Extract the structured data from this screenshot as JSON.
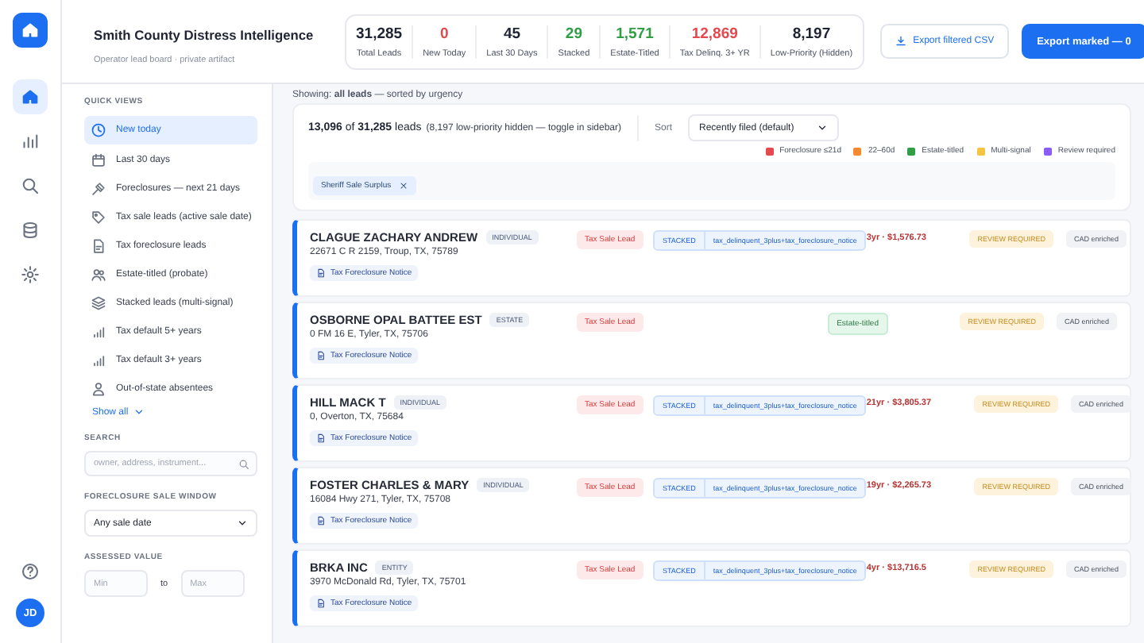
{
  "rail": {
    "avatar": "JD",
    "items": [
      {
        "kind": "home",
        "selected": true
      },
      {
        "kind": "chart",
        "selected": false
      },
      {
        "kind": "search",
        "selected": false
      },
      {
        "kind": "database",
        "selected": false
      },
      {
        "kind": "settings",
        "selected": false
      }
    ]
  },
  "header": {
    "title": "Smith County Distress Intelligence",
    "subtitle": "Operator lead board · private artifact",
    "stats": [
      {
        "value": "31,285",
        "label": "Total Leads",
        "color": "#1f2433"
      },
      {
        "value": "0",
        "label": "New Today",
        "color": "#e5484d"
      },
      {
        "value": "45",
        "label": "Last 30 Days",
        "color": "#1f2433"
      },
      {
        "value": "29",
        "label": "Stacked",
        "color": "#2f9e44"
      },
      {
        "value": "1,571",
        "label": "Estate-Titled",
        "color": "#2f9e44"
      },
      {
        "value": "12,869",
        "label": "Tax Delinq. 3+ YR",
        "color": "#e5484d"
      },
      {
        "value": "8,197",
        "label": "Low-Priority (Hidden)",
        "color": "#1f2433"
      }
    ],
    "csv_button": "Export filtered CSV",
    "export_button": "Export marked — 0"
  },
  "sidebar": {
    "quick_views_title": "QUICK VIEWS",
    "quick_views": [
      {
        "label": "New today",
        "kind": "clock",
        "selected": true
      },
      {
        "label": "Last 30 days",
        "kind": "calendar",
        "selected": false
      },
      {
        "label": "Foreclosures — next 21 days",
        "kind": "gavel",
        "selected": false
      },
      {
        "label": "Tax sale leads (active sale date)",
        "kind": "tag",
        "selected": false
      },
      {
        "label": "Tax foreclosure leads",
        "kind": "doc",
        "selected": false
      },
      {
        "label": "Estate-titled (probate)",
        "kind": "people",
        "selected": false
      },
      {
        "label": "Stacked leads (multi-signal)",
        "kind": "layers",
        "selected": false
      },
      {
        "label": "Tax default 5+ years",
        "kind": "bars",
        "selected": false
      },
      {
        "label": "Tax default 3+ years",
        "kind": "bars",
        "selected": false
      },
      {
        "label": "Out-of-state absentees",
        "kind": "person",
        "selected": false
      }
    ],
    "show_all": "Show all",
    "search_label": "SEARCH",
    "search_placeholder": "owner, address, instrument...",
    "window_label": "FORECLOSURE SALE WINDOW",
    "window_value": "Any sale date",
    "assessed_label": "ASSESSED VALUE",
    "min_placeholder": "Min",
    "to": "to",
    "max_placeholder": "Max"
  },
  "main": {
    "showing": "Showing: **all leads** — sorted by urgency",
    "count": "**13,096** of **31,285** leads",
    "count_note": "(8,197 low-priority hidden — toggle in sidebar)",
    "sort_label": "Sort",
    "sort_value": "Recently filed (default)",
    "legend": [
      {
        "label": "Foreclosure ≤21d",
        "color": "#e5484d"
      },
      {
        "label": "22–60d",
        "color": "#f5892f"
      },
      {
        "label": "Estate-titled",
        "color": "#2f9e44"
      },
      {
        "label": "Multi-signal",
        "color": "#f5c542"
      },
      {
        "label": "Review required",
        "color": "#8b5cf6"
      }
    ],
    "chips": [
      "Sheriff Sale Surplus"
    ],
    "leads": [
      {
        "name": "CLAGUE ZACHARY ANDREW",
        "type": "INDIVIDUAL",
        "address": "22671 C R 2159, Troup, TX, 75789",
        "notice": "Tax Foreclosure Notice",
        "lead_tag": "Tax Sale Lead",
        "stacked": "STACKED",
        "signals": "tax_delinquent_3plus+tax_foreclosure_notice",
        "amount": "3yr · $1,576.73",
        "review": "REVIEW REQUIRED",
        "enrichment": "CAD enriched"
      },
      {
        "name": "OSBORNE OPAL BATTEE EST",
        "type": "ESTATE",
        "address": "0 FM 16 E, Tyler, TX, 75706",
        "notice": "Tax Foreclosure Notice",
        "lead_tag": "Tax Sale Lead",
        "estate_tag": "Estate-titled",
        "review": "REVIEW REQUIRED",
        "enrichment": "CAD enriched"
      },
      {
        "name": "HILL MACK T",
        "type": "INDIVIDUAL",
        "address": "0, Overton, TX, 75684",
        "notice": "Tax Foreclosure Notice",
        "lead_tag": "Tax Sale Lead",
        "stacked": "STACKED",
        "signals": "tax_delinquent_3plus+tax_foreclosure_notice",
        "amount": "21yr · $3,805.37",
        "review": "REVIEW REQUIRED",
        "enrichment": "CAD enriched"
      },
      {
        "name": "FOSTER CHARLES & MARY",
        "type": "INDIVIDUAL",
        "address": "16084 Hwy 271, Tyler, TX, 75708",
        "notice": "Tax Foreclosure Notice",
        "lead_tag": "Tax Sale Lead",
        "stacked": "STACKED",
        "signals": "tax_delinquent_3plus+tax_foreclosure_notice",
        "amount": "19yr · $2,265.73",
        "review": "REVIEW REQUIRED",
        "enrichment": "CAD enriched"
      },
      {
        "name": "BRKA INC",
        "type": "ENTITY",
        "address": "3970 McDonald Rd, Tyler, TX, 75701",
        "notice": "Tax Foreclosure Notice",
        "lead_tag": "Tax Sale Lead",
        "stacked": "STACKED",
        "signals": "tax_delinquent_3plus+tax_foreclosure_notice",
        "amount": "4yr · $13,716.5",
        "review": "REVIEW REQUIRED",
        "enrichment": "CAD enriched"
      }
    ]
  }
}
